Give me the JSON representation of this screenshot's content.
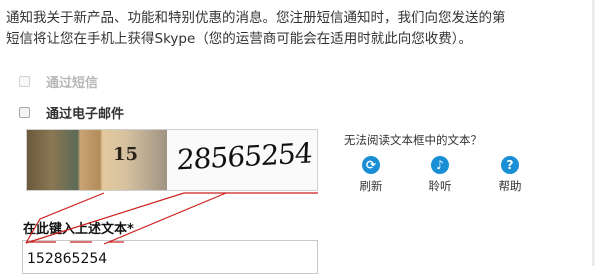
{
  "intro": {
    "line1": "通知我关于新产品、功能和特别优惠的消息。您注册短信通知时，我们向您发送的第",
    "line2": "短信将让您在手机上获得Skype（您的运营商可能会在适用时就此向您收费）。"
  },
  "options": {
    "sms_label": "通过短信",
    "email_label": "通过电子邮件"
  },
  "captcha": {
    "photo_text": "15",
    "word_text": "28565254"
  },
  "captcha_help": {
    "title": "无法阅读文本框中的文本？",
    "refresh_label": "刷新",
    "listen_label": "聆听",
    "help_label": "帮助"
  },
  "entry": {
    "label": "在此键入上述文本*",
    "value": "152865254"
  },
  "colors": {
    "accent": "#1a8fd6",
    "annotation": "#cc1f1f",
    "disabled_text": "#b8b8b8"
  }
}
